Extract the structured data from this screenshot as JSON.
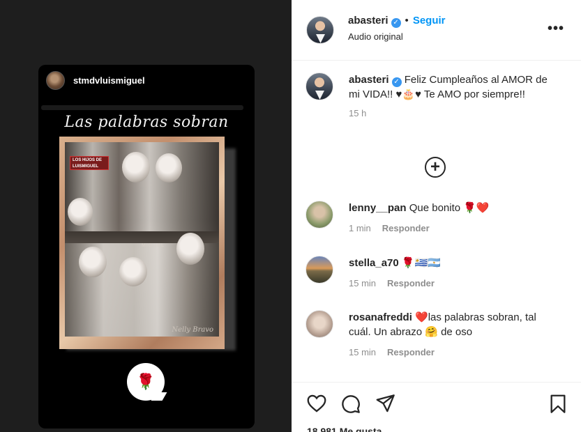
{
  "story": {
    "username": "stmdvluismiguel",
    "title": "Las palabras sobran",
    "photo_logo": "LOS HIJOS DE\nLUISMIGUEL",
    "photo_label": "MIGUEL",
    "photo_sign": "Nelly Bravo",
    "reaction_emoji": "🌹"
  },
  "post": {
    "author": "abasteri",
    "follow_label": "Seguir",
    "audio_label": "Audio original",
    "more_label": "•••"
  },
  "caption": {
    "author": "abasteri",
    "text": "Feliz Cumpleaños al AMOR de mi VIDA!! ♥🎂♥ Te AMO por siempre!!",
    "time": "15 h"
  },
  "load_more_label": "+",
  "comments": [
    {
      "user": "lenny__pan",
      "text": "Que bonito 🌹❤️",
      "time": "1 min",
      "reply": "Responder"
    },
    {
      "user": "stella_a70",
      "text": "🌹🇺🇾🇦🇷",
      "time": "15 min",
      "reply": "Responder"
    },
    {
      "user": "rosanafreddi",
      "text": "❤️las palabras sobran, tal cuál. Un abrazo 🤗 de oso",
      "time": "15 min",
      "reply": "Responder"
    }
  ],
  "likes_label": "18.981 Me gusta",
  "colors": {
    "accent": "#0095f6",
    "verified": "#3897f0"
  }
}
